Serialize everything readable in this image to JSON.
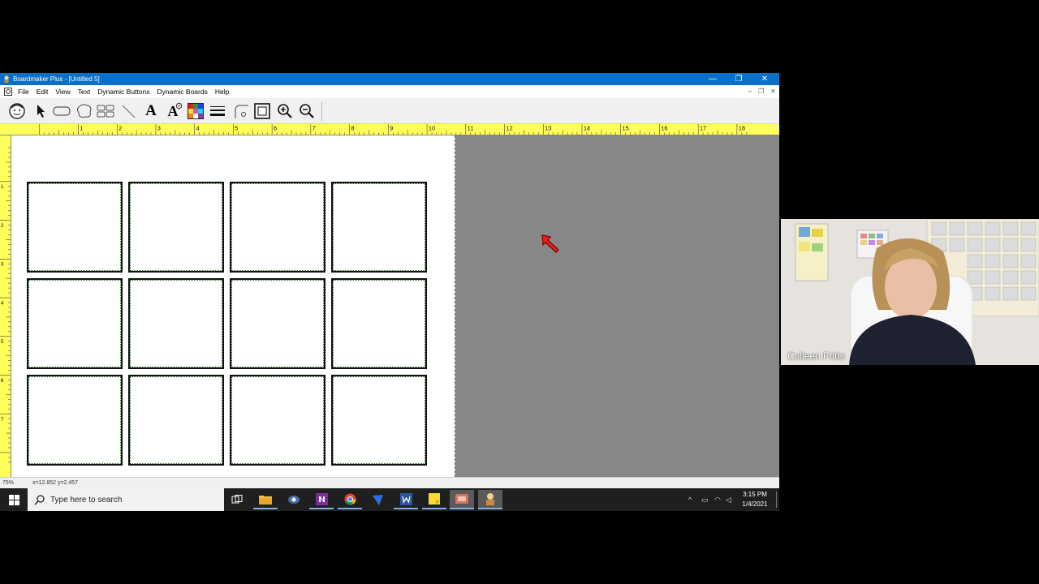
{
  "window": {
    "title": "Boardmaker Plus - [Untitled 5]",
    "minimize": "—",
    "restore": "❐",
    "close": "✕"
  },
  "menu": {
    "items": [
      "File",
      "Edit",
      "View",
      "Text",
      "Dynamic Buttons",
      "Dynamic Boards",
      "Help"
    ],
    "mdi_min": "–",
    "mdi_restore": "❐",
    "mdi_close": "✕"
  },
  "toolbar": {
    "tools": [
      "symbol-finder",
      "pointer",
      "button",
      "freeform",
      "grid",
      "line",
      "text",
      "text-format",
      "color",
      "line-thickness",
      "corner",
      "border",
      "zoom-in",
      "zoom-out"
    ],
    "text_glyph": "A",
    "text_format_glyph": "A"
  },
  "ruler_h": {
    "labels": [
      "1",
      "2",
      "3",
      "4",
      "5",
      "6",
      "7",
      "8",
      "9",
      "10",
      "11",
      "12",
      "13",
      "14",
      "15",
      "16",
      "17",
      "18"
    ]
  },
  "ruler_v": {
    "labels": [
      "1",
      "2",
      "3",
      "4",
      "5",
      "6",
      "7"
    ]
  },
  "grid": {
    "rows": 3,
    "cols": 4
  },
  "statusbar": {
    "zoom": "75%",
    "coords": "x=12.852   y=2.457"
  },
  "taskbar": {
    "search_placeholder": "Type here to search",
    "time": "3:15 PM",
    "date": "1/4/2021",
    "apps": [
      "task-view",
      "file-explorer",
      "snipping",
      "onenote",
      "chrome",
      "vpn",
      "word",
      "sticky-notes",
      "camera-app",
      "boardmaker"
    ]
  },
  "webcam": {
    "participant_name": "Colleen Fritts"
  },
  "colors": {
    "titlebar": "#0a6fc8",
    "ruler": "#ffff5c",
    "canvas_bg": "#878787",
    "cursor": "#e8201a"
  }
}
